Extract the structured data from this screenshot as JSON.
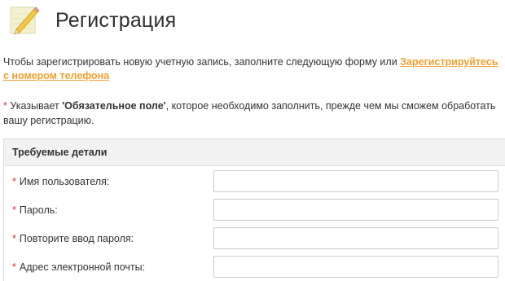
{
  "header": {
    "title": "Регистрация",
    "icon": "notepad-pencil-icon"
  },
  "intro": {
    "text": "Чтобы зарегистрировать новую учетную запись, заполните следующую форму или ",
    "link": "Зарегистрируйтесь с номером телефона"
  },
  "required_note": {
    "star": "*",
    "before": " Указывает ",
    "bold": "'Обязательное поле'",
    "after": ", которое необходимо заполнить, прежде чем мы сможем обработать вашу регистрацию."
  },
  "form": {
    "legend": "Требуемые детали",
    "star": "*",
    "fields": [
      {
        "label": "Имя пользователя:",
        "value": ""
      },
      {
        "label": "Пароль:",
        "value": ""
      },
      {
        "label": "Повторите ввод пароля:",
        "value": ""
      },
      {
        "label": "Адрес электронной почты:",
        "value": ""
      }
    ]
  },
  "colors": {
    "link": "#f0a030",
    "required_star": "#d9302c",
    "legend_bg": "#f2f2f2"
  }
}
